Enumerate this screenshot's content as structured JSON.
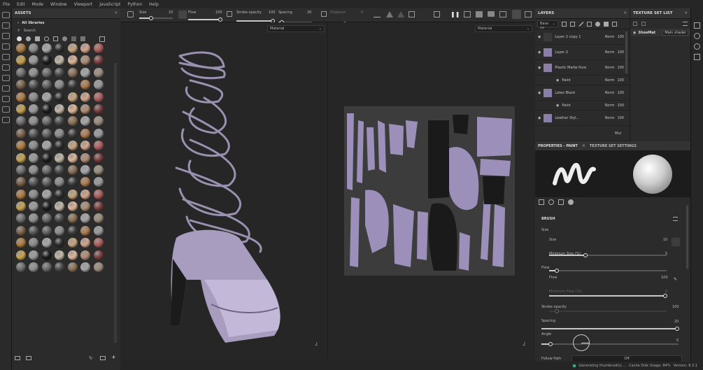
{
  "menu": [
    "File",
    "Edit",
    "Mode",
    "Window",
    "Viewport",
    "JavaScript",
    "Python",
    "Help"
  ],
  "assets": {
    "title": "ASSETS",
    "library": "All libraries",
    "search_placeholder": "Search",
    "swatch_colors": [
      "#b07a3a",
      "#8a8a8a",
      "#a8a8a8",
      "#2a2a2a",
      "#c9a57d",
      "#d6a48a",
      "#b05a58",
      "#c9a24a",
      "#9a9a9a",
      "#1a1a1a",
      "#c2b8a6",
      "#e0b597",
      "#b08b70",
      "#7a3a3a",
      "#6d6d6d",
      "#8f8f8f",
      "#6a6a6a",
      "#4a4a4a",
      "#8b6f52",
      "#a6a6a6",
      "#9c8b7a",
      "#7a6046",
      "#575757",
      "#606060",
      "#8a8a8a",
      "#3d3d3d",
      "#b07a4a",
      "#9a9a9a"
    ]
  },
  "toolbar": {
    "size_label": "Size",
    "size_value": "10",
    "flow_label": "Flow",
    "flow_value": "100",
    "stroke_label": "Stroke opacity",
    "stroke_value": "100",
    "spacing_label": "Spacing",
    "spacing_value": "20",
    "distance_label": "Distance",
    "distance_value": "0"
  },
  "viewport": {
    "left_mode": "Material",
    "right_mode": "Material"
  },
  "layers": {
    "title": "LAYERS",
    "channel": "Base co",
    "rows": [
      {
        "name": "Layer 2 copy 1",
        "blend": "Norm",
        "opacity": "100"
      },
      {
        "name": "Layer 2",
        "blend": "Norm",
        "opacity": "100"
      },
      {
        "name": "Plastic Matte Pure",
        "blend": "Norm",
        "opacity": "100"
      },
      {
        "name": "Paint",
        "blend": "Norm",
        "opacity": "100"
      },
      {
        "name": "Latex Black",
        "blend": "Norm",
        "opacity": "100"
      },
      {
        "name": "Paint",
        "blend": "Norm",
        "opacity": "100"
      },
      {
        "name": "Leather Styl...",
        "blend": "Norm",
        "opacity": "100"
      }
    ],
    "last_blend": "Mul"
  },
  "texture_set_list": {
    "title": "TEXTURE SET LIST",
    "set_name": "ShoeMat",
    "shader": "Main shader"
  },
  "properties": {
    "tab_paint": "PROPERTIES - PAINT",
    "tab_settings": "TEXTURE SET SETTINGS",
    "section": "BRUSH",
    "size_group": "Size",
    "size": {
      "label": "Size",
      "value": "10"
    },
    "min_size": {
      "label": "Minimum Size (%)",
      "value": "5"
    },
    "flow_group": "Flow",
    "flow": {
      "label": "Flow",
      "value": "100"
    },
    "min_flow": {
      "label": "Minimum Flow (%)",
      "value": "0"
    },
    "stroke": {
      "label": "Stroke opacity",
      "value": "100"
    },
    "spacing": {
      "label": "Spacing",
      "value": "20"
    },
    "angle": {
      "label": "Angle",
      "value": "0"
    },
    "follow": {
      "label": "Follow Path",
      "value": "Off"
    }
  },
  "status": {
    "text": "Generating thumbnail(s) ...",
    "cache": "Cache Disk Usage: 84%",
    "version": "Version: 8.3.1"
  }
}
